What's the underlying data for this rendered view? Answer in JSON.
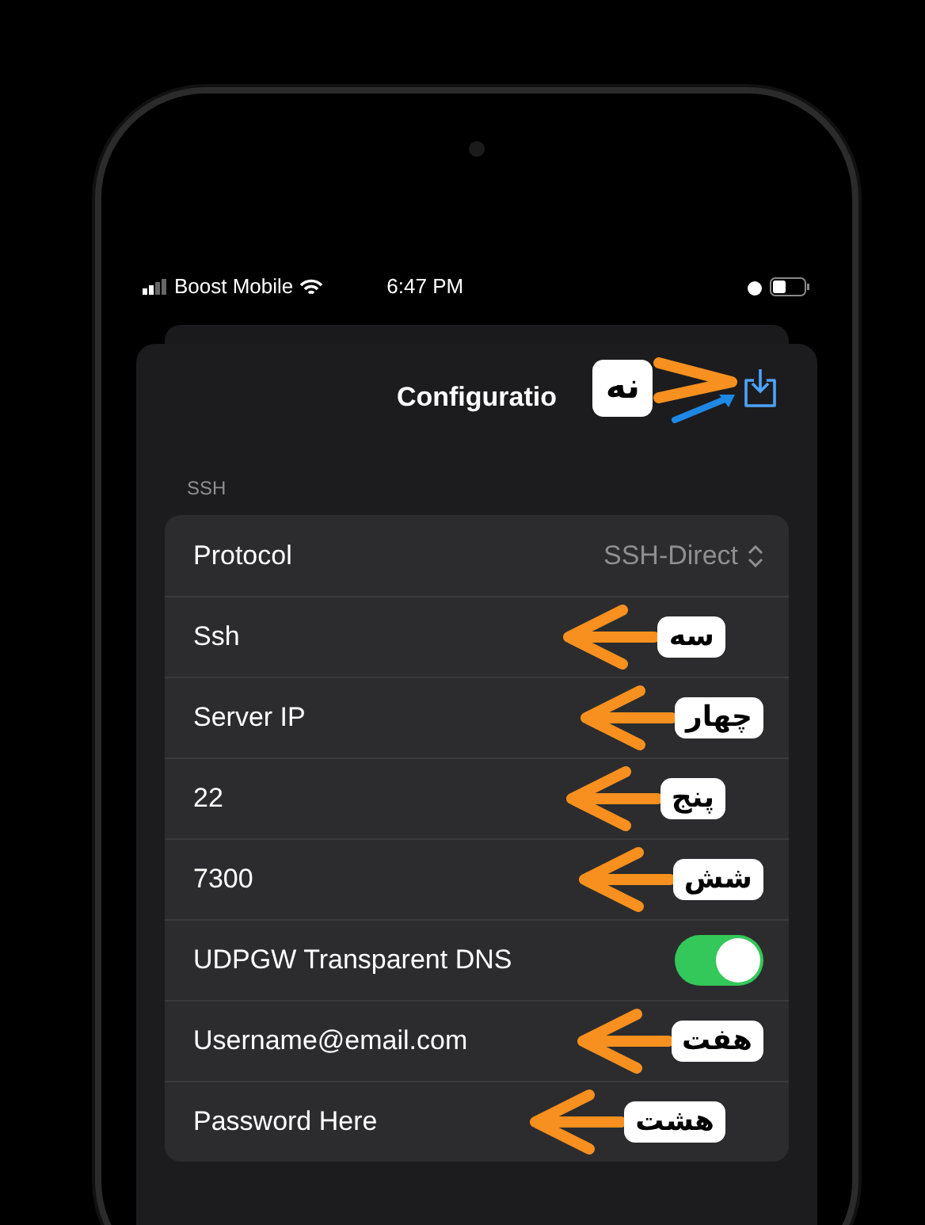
{
  "status_bar": {
    "carrier": "Boost Mobile",
    "time": "6:47 PM"
  },
  "sheet": {
    "title": "Configuratio",
    "title_callout": "نه"
  },
  "section": {
    "header": "SSH",
    "rows": [
      {
        "kind": "picker",
        "label": "Protocol",
        "value": "SSH-Direct"
      },
      {
        "kind": "field",
        "label": "Ssh",
        "callout": "سه"
      },
      {
        "kind": "field",
        "label": "Server IP",
        "callout": "چهار"
      },
      {
        "kind": "field",
        "label": "22",
        "callout": "پنج"
      },
      {
        "kind": "field",
        "label": "7300",
        "callout": "شش"
      },
      {
        "kind": "toggle",
        "label": "UDPGW Transparent DNS",
        "on": true
      },
      {
        "kind": "field",
        "label": "Username@email.com",
        "callout": "هفت"
      },
      {
        "kind": "field",
        "label": "Password Here",
        "callout": "هشت"
      }
    ]
  }
}
